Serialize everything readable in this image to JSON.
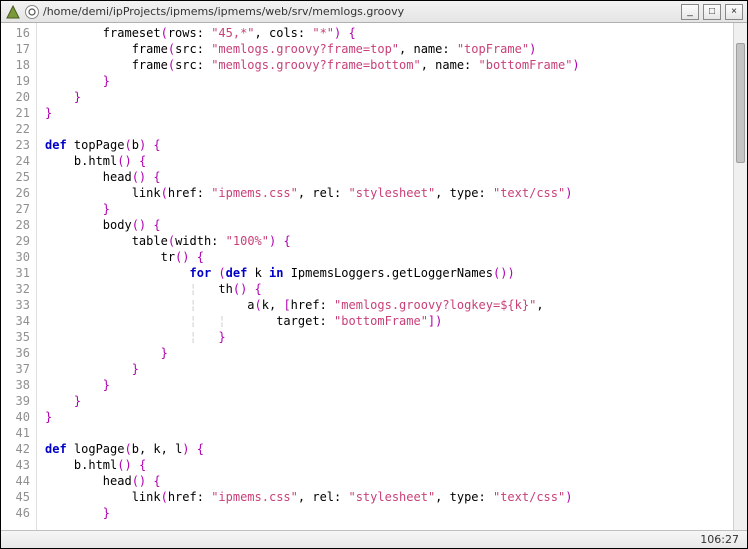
{
  "window": {
    "title": "/home/demi/ipProjects/ipmems/ipmems/web/srv/memlogs.groovy",
    "minimize": "_",
    "maximize": "□",
    "close": "×"
  },
  "status": {
    "position": "106:27"
  },
  "lines": [
    {
      "n": 16,
      "tokens": [
        {
          "t": "pl",
          "v": "        frameset"
        },
        {
          "t": "br",
          "v": "("
        },
        {
          "t": "pl",
          "v": "rows: "
        },
        {
          "t": "str",
          "v": "\"45,*\""
        },
        {
          "t": "pl",
          "v": ", cols: "
        },
        {
          "t": "str",
          "v": "\"*\""
        },
        {
          "t": "br",
          "v": ")"
        },
        {
          "t": "pl",
          "v": " "
        },
        {
          "t": "br",
          "v": "{"
        }
      ]
    },
    {
      "n": 17,
      "tokens": [
        {
          "t": "pl",
          "v": "            frame"
        },
        {
          "t": "br",
          "v": "("
        },
        {
          "t": "pl",
          "v": "src: "
        },
        {
          "t": "str",
          "v": "\"memlogs.groovy?frame=top\""
        },
        {
          "t": "pl",
          "v": ", name: "
        },
        {
          "t": "str",
          "v": "\"topFrame\""
        },
        {
          "t": "br",
          "v": ")"
        }
      ]
    },
    {
      "n": 18,
      "tokens": [
        {
          "t": "pl",
          "v": "            frame"
        },
        {
          "t": "br",
          "v": "("
        },
        {
          "t": "pl",
          "v": "src: "
        },
        {
          "t": "str",
          "v": "\"memlogs.groovy?frame=bottom\""
        },
        {
          "t": "pl",
          "v": ", name: "
        },
        {
          "t": "str",
          "v": "\"bottomFrame\""
        },
        {
          "t": "br",
          "v": ")"
        }
      ]
    },
    {
      "n": 19,
      "tokens": [
        {
          "t": "pl",
          "v": "        "
        },
        {
          "t": "br",
          "v": "}"
        }
      ]
    },
    {
      "n": 20,
      "tokens": [
        {
          "t": "pl",
          "v": "    "
        },
        {
          "t": "br",
          "v": "}"
        }
      ]
    },
    {
      "n": 21,
      "tokens": [
        {
          "t": "br",
          "v": "}"
        }
      ]
    },
    {
      "n": 22,
      "tokens": [
        {
          "t": "pl",
          "v": ""
        }
      ]
    },
    {
      "n": 23,
      "tokens": [
        {
          "t": "kw",
          "v": "def"
        },
        {
          "t": "pl",
          "v": " topPage"
        },
        {
          "t": "br",
          "v": "("
        },
        {
          "t": "pl",
          "v": "b"
        },
        {
          "t": "br",
          "v": ")"
        },
        {
          "t": "pl",
          "v": " "
        },
        {
          "t": "br",
          "v": "{"
        }
      ]
    },
    {
      "n": 24,
      "tokens": [
        {
          "t": "pl",
          "v": "    b.html"
        },
        {
          "t": "br",
          "v": "()"
        },
        {
          "t": "pl",
          "v": " "
        },
        {
          "t": "br",
          "v": "{"
        }
      ]
    },
    {
      "n": 25,
      "tokens": [
        {
          "t": "pl",
          "v": "        head"
        },
        {
          "t": "br",
          "v": "()"
        },
        {
          "t": "pl",
          "v": " "
        },
        {
          "t": "br",
          "v": "{"
        }
      ]
    },
    {
      "n": 26,
      "tokens": [
        {
          "t": "pl",
          "v": "            link"
        },
        {
          "t": "br",
          "v": "("
        },
        {
          "t": "pl",
          "v": "href: "
        },
        {
          "t": "str",
          "v": "\"ipmems.css\""
        },
        {
          "t": "pl",
          "v": ", rel: "
        },
        {
          "t": "str",
          "v": "\"stylesheet\""
        },
        {
          "t": "pl",
          "v": ", type: "
        },
        {
          "t": "str",
          "v": "\"text/css\""
        },
        {
          "t": "br",
          "v": ")"
        }
      ]
    },
    {
      "n": 27,
      "tokens": [
        {
          "t": "pl",
          "v": "        "
        },
        {
          "t": "br",
          "v": "}"
        }
      ]
    },
    {
      "n": 28,
      "tokens": [
        {
          "t": "pl",
          "v": "        body"
        },
        {
          "t": "br",
          "v": "()"
        },
        {
          "t": "pl",
          "v": " "
        },
        {
          "t": "br",
          "v": "{"
        }
      ]
    },
    {
      "n": 29,
      "tokens": [
        {
          "t": "pl",
          "v": "            table"
        },
        {
          "t": "br",
          "v": "("
        },
        {
          "t": "pl",
          "v": "width: "
        },
        {
          "t": "str",
          "v": "\"100%\""
        },
        {
          "t": "br",
          "v": ")"
        },
        {
          "t": "pl",
          "v": " "
        },
        {
          "t": "br",
          "v": "{"
        }
      ]
    },
    {
      "n": 30,
      "tokens": [
        {
          "t": "pl",
          "v": "                tr"
        },
        {
          "t": "br",
          "v": "()"
        },
        {
          "t": "pl",
          "v": " "
        },
        {
          "t": "br",
          "v": "{"
        }
      ]
    },
    {
      "n": 31,
      "tokens": [
        {
          "t": "pl",
          "v": "                    "
        },
        {
          "t": "kw",
          "v": "for"
        },
        {
          "t": "pl",
          "v": " "
        },
        {
          "t": "br",
          "v": "("
        },
        {
          "t": "kw",
          "v": "def"
        },
        {
          "t": "pl",
          "v": " k "
        },
        {
          "t": "kw",
          "v": "in"
        },
        {
          "t": "pl",
          "v": " IpmemsLoggers.getLoggerNames"
        },
        {
          "t": "br",
          "v": "())"
        }
      ]
    },
    {
      "n": 32,
      "tokens": [
        {
          "t": "guide",
          "v": "                    ¦   "
        },
        {
          "t": "pl",
          "v": "th"
        },
        {
          "t": "br",
          "v": "()"
        },
        {
          "t": "pl",
          "v": " "
        },
        {
          "t": "br",
          "v": "{"
        }
      ]
    },
    {
      "n": 33,
      "tokens": [
        {
          "t": "guide",
          "v": "                    ¦   "
        },
        {
          "t": "pl",
          "v": "    a"
        },
        {
          "t": "br",
          "v": "("
        },
        {
          "t": "pl",
          "v": "k, "
        },
        {
          "t": "br",
          "v": "["
        },
        {
          "t": "pl",
          "v": "href: "
        },
        {
          "t": "str",
          "v": "\"memlogs.groovy?logkey=${k}\""
        },
        {
          "t": "pl",
          "v": ","
        }
      ]
    },
    {
      "n": 34,
      "tokens": [
        {
          "t": "guide",
          "v": "                    ¦   ¦   "
        },
        {
          "t": "pl",
          "v": "    target: "
        },
        {
          "t": "str",
          "v": "\"bottomFrame\""
        },
        {
          "t": "br",
          "v": "])"
        }
      ]
    },
    {
      "n": 35,
      "tokens": [
        {
          "t": "guide",
          "v": "                    ¦   "
        },
        {
          "t": "br",
          "v": "}"
        }
      ]
    },
    {
      "n": 36,
      "tokens": [
        {
          "t": "pl",
          "v": "                "
        },
        {
          "t": "br",
          "v": "}"
        }
      ]
    },
    {
      "n": 37,
      "tokens": [
        {
          "t": "pl",
          "v": "            "
        },
        {
          "t": "br",
          "v": "}"
        }
      ]
    },
    {
      "n": 38,
      "tokens": [
        {
          "t": "pl",
          "v": "        "
        },
        {
          "t": "br",
          "v": "}"
        }
      ]
    },
    {
      "n": 39,
      "tokens": [
        {
          "t": "pl",
          "v": "    "
        },
        {
          "t": "br",
          "v": "}"
        }
      ]
    },
    {
      "n": 40,
      "tokens": [
        {
          "t": "br",
          "v": "}"
        }
      ]
    },
    {
      "n": 41,
      "tokens": [
        {
          "t": "pl",
          "v": ""
        }
      ]
    },
    {
      "n": 42,
      "tokens": [
        {
          "t": "kw",
          "v": "def"
        },
        {
          "t": "pl",
          "v": " logPage"
        },
        {
          "t": "br",
          "v": "("
        },
        {
          "t": "pl",
          "v": "b, k, l"
        },
        {
          "t": "br",
          "v": ")"
        },
        {
          "t": "pl",
          "v": " "
        },
        {
          "t": "br",
          "v": "{"
        }
      ]
    },
    {
      "n": 43,
      "tokens": [
        {
          "t": "pl",
          "v": "    b.html"
        },
        {
          "t": "br",
          "v": "()"
        },
        {
          "t": "pl",
          "v": " "
        },
        {
          "t": "br",
          "v": "{"
        }
      ]
    },
    {
      "n": 44,
      "tokens": [
        {
          "t": "pl",
          "v": "        head"
        },
        {
          "t": "br",
          "v": "()"
        },
        {
          "t": "pl",
          "v": " "
        },
        {
          "t": "br",
          "v": "{"
        }
      ]
    },
    {
      "n": 45,
      "tokens": [
        {
          "t": "pl",
          "v": "            link"
        },
        {
          "t": "br",
          "v": "("
        },
        {
          "t": "pl",
          "v": "href: "
        },
        {
          "t": "str",
          "v": "\"ipmems.css\""
        },
        {
          "t": "pl",
          "v": ", rel: "
        },
        {
          "t": "str",
          "v": "\"stylesheet\""
        },
        {
          "t": "pl",
          "v": ", type: "
        },
        {
          "t": "str",
          "v": "\"text/css\""
        },
        {
          "t": "br",
          "v": ")"
        }
      ]
    },
    {
      "n": 46,
      "tokens": [
        {
          "t": "pl",
          "v": "        "
        },
        {
          "t": "br",
          "v": "}"
        }
      ]
    }
  ]
}
